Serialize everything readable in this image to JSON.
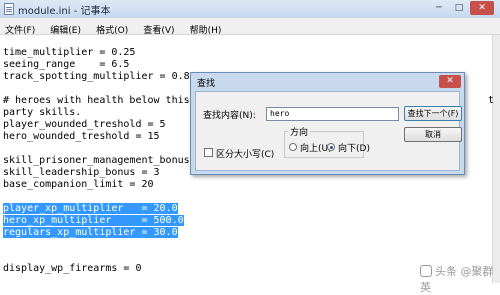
{
  "window": {
    "title": "module.ini - 记事本",
    "minimize": "─",
    "maximize": "□",
    "close": "✕"
  },
  "menu": [
    "文件(F)",
    "编辑(E)",
    "格式(O)",
    "查看(V)",
    "帮助(H)"
  ],
  "editor": {
    "lines": [
      "time_multiplier = 0.25",
      "seeing_range    = 6.5",
      "track_spotting_multiplier = 0.8",
      "",
      "# heroes with health below this",
      "party skills.",
      "player_wounded_treshold = 5",
      "hero_wounded_treshold = 15",
      "",
      "skill_prisoner_management_bonus",
      "skill_leadership_bonus = 3",
      "base_companion_limit = 20",
      "",
      "player_xp_multiplier   = 20.0",
      "hero_xp_multiplier     = 500.0",
      "regulars_xp_multiplier = 30.0",
      "",
      "",
      "display_wp_firearms = 0"
    ],
    "overflow_right": "t"
  },
  "find_dialog": {
    "title": "查找",
    "find_label": "查找内容(N):",
    "find_value": "hero",
    "find_next_button": "查找下一个(F)",
    "cancel_button": "取消",
    "direction_label": "方向",
    "up_label": "向上(U)",
    "down_label": "向下(D)",
    "direction_selected": "down",
    "match_case_label": "区分大小写(C)",
    "match_case_checked": false
  },
  "watermark": "头条 @聚群英"
}
